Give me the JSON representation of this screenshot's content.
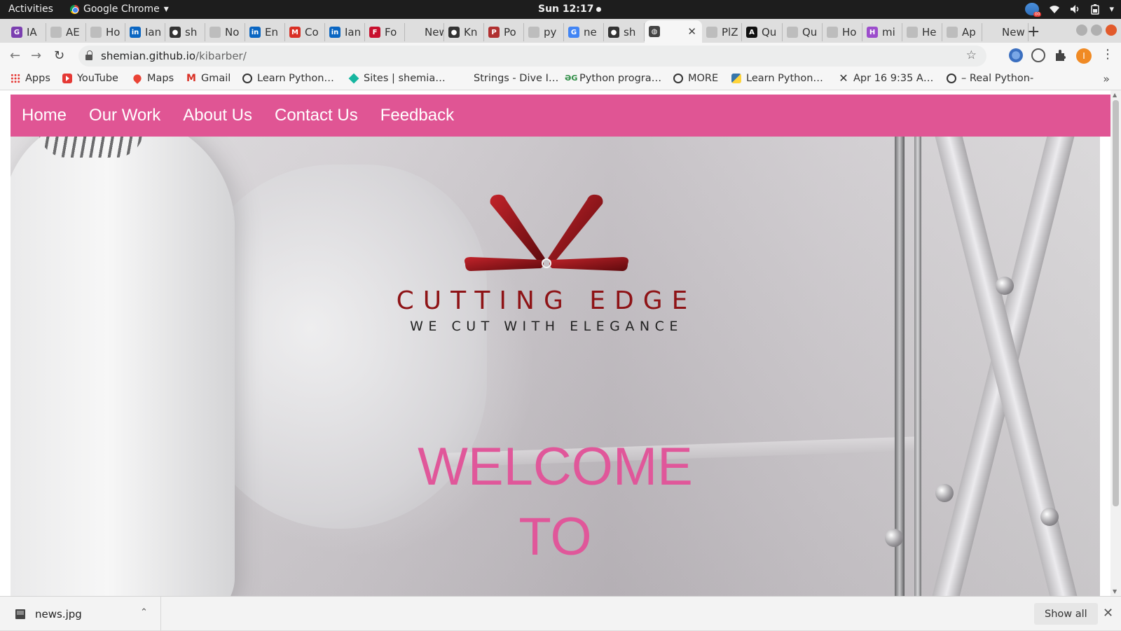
{
  "os_bar": {
    "activities": "Activities",
    "app_name": "Google Chrome",
    "app_menu_arrow": "▾",
    "clock": "Sun 12:17"
  },
  "tabs": [
    {
      "label": "IA",
      "fav": "G",
      "fav_color": "#7b3fb0"
    },
    {
      "label": "AE",
      "fav": "",
      "fav_color": "#bdbdbd"
    },
    {
      "label": "Ho",
      "fav": "",
      "fav_color": "#bdbdbd"
    },
    {
      "label": "Ian",
      "fav": "in",
      "fav_color": "#0a66c2"
    },
    {
      "label": "sh",
      "fav": "●",
      "fav_color": "#333333"
    },
    {
      "label": "No",
      "fav": "",
      "fav_color": "#bdbdbd"
    },
    {
      "label": "En",
      "fav": "in",
      "fav_color": "#0a66c2"
    },
    {
      "label": "Co",
      "fav": "M",
      "fav_color": "#d93025"
    },
    {
      "label": "Ian",
      "fav": "in",
      "fav_color": "#0a66c2"
    },
    {
      "label": "Fo",
      "fav": "F",
      "fav_color": "#c8102e"
    },
    {
      "label": "New T",
      "fav": "",
      "fav_color": "#dedede"
    },
    {
      "label": "Kn",
      "fav": "●",
      "fav_color": "#333333"
    },
    {
      "label": "Po",
      "fav": "P",
      "fav_color": "#b03030"
    },
    {
      "label": "py",
      "fav": "",
      "fav_color": "#bdbdbd"
    },
    {
      "label": "ne",
      "fav": "G",
      "fav_color": "#4285f4"
    },
    {
      "label": "sh",
      "fav": "●",
      "fav_color": "#333333"
    },
    {
      "label": "",
      "fav": "◍",
      "fav_color": "#444444",
      "active": true
    },
    {
      "label": "PlZ",
      "fav": "",
      "fav_color": "#bdbdbd"
    },
    {
      "label": "Qu",
      "fav": "A",
      "fav_color": "#111111"
    },
    {
      "label": "Qu",
      "fav": "",
      "fav_color": "#bdbdbd"
    },
    {
      "label": "Ho",
      "fav": "",
      "fav_color": "#bdbdbd"
    },
    {
      "label": "mi",
      "fav": "H",
      "fav_color": "#9c4dcc"
    },
    {
      "label": "He",
      "fav": "",
      "fav_color": "#bdbdbd"
    },
    {
      "label": "Ap",
      "fav": "",
      "fav_color": "#bdbdbd"
    },
    {
      "label": "New T",
      "fav": "",
      "fav_color": "#dedede"
    }
  ],
  "tab_close": "✕",
  "new_tab": "+",
  "toolbar": {
    "back": "←",
    "forward": "→",
    "reload": "↻",
    "url_host": "shemian.github.io",
    "url_path": "/kibarber/",
    "star": "☆",
    "avatar_letter": "I",
    "menu": "⋮"
  },
  "bookmarks": [
    {
      "label": "Apps",
      "icon": "grid-icon"
    },
    {
      "label": "YouTube",
      "icon": "youtube-icon"
    },
    {
      "label": "Maps",
      "icon": "maps-icon"
    },
    {
      "label": "Gmail",
      "icon": "gmail-icon"
    },
    {
      "label": "Learn Python…",
      "icon": "globe-icon"
    },
    {
      "label": "Sites | shemia…",
      "icon": "sites-icon"
    },
    {
      "label": "Strings - Dive I…",
      "icon": "blank-icon"
    },
    {
      "label": "Python progra…",
      "icon": "gfg-icon"
    },
    {
      "label": "MORE",
      "icon": "globe-icon"
    },
    {
      "label": "Learn Python…",
      "icon": "python-icon"
    },
    {
      "label": "Apr 16 9:35 A…",
      "icon": "x-icon"
    },
    {
      "label": "– Real Python-",
      "icon": "globe-icon"
    }
  ],
  "bookmarks_more": "»",
  "site": {
    "nav": [
      "Home",
      "Our Work",
      "About Us",
      "Contact Us",
      "Feedback"
    ],
    "logo_title": "CUTTING EDGE",
    "logo_tagline": "WE CUT WITH ELEGANCE",
    "welcome_line1": "WELCOME",
    "welcome_line2": "TO",
    "brand_pink": "#e05594",
    "logo_red": "#8e1316"
  },
  "downloads": {
    "file_name": "news.jpg",
    "chevron": "⌃",
    "show_all": "Show all",
    "close": "✕"
  }
}
